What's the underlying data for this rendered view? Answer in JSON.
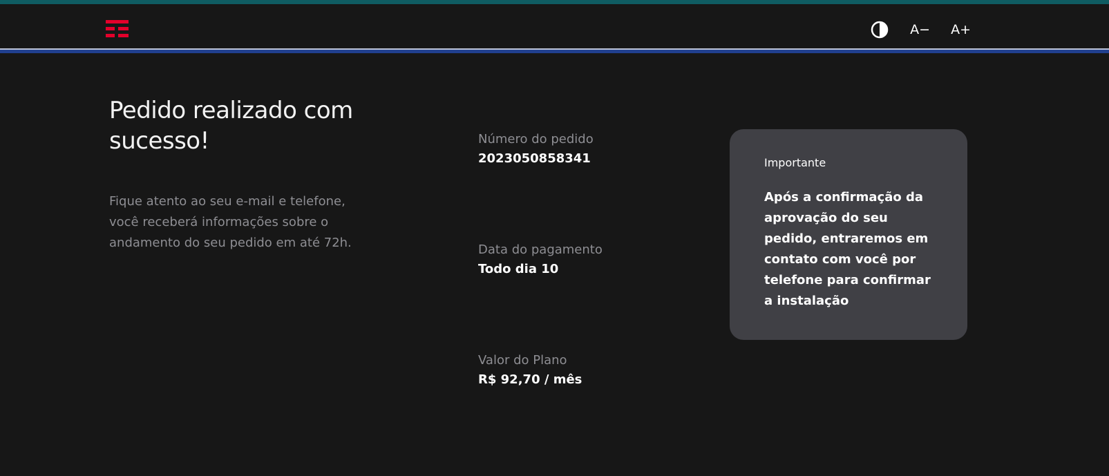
{
  "header": {
    "logo_icon": "tim-logo-icon",
    "contrast_icon": "contrast-icon",
    "font_decrease_label": "A−",
    "font_increase_label": "A+"
  },
  "main": {
    "title": "Pedido realizado com sucesso!",
    "subtitle": "Fique atento ao seu e-mail e telefone, você receberá informações sobre o andamento do seu pedido em até 72h."
  },
  "order": {
    "number_label": "Número do pedido",
    "number_value": "2023050858341",
    "payment_label": "Data do pagamento",
    "payment_value": "Todo dia 10",
    "plan_label": "Valor do Plano",
    "plan_value": "R$ 92,70 / mês"
  },
  "notice": {
    "label": "Importante",
    "text": "Após a confirmação da aprovação do seu pedido, entraremos em contato com você por telefone para confirmar a instalação"
  },
  "colors": {
    "background": "#171717",
    "accent_red": "#e4002b",
    "accent_blue": "#21408f",
    "card_background": "#404045",
    "muted_text": "#8e8e93"
  }
}
